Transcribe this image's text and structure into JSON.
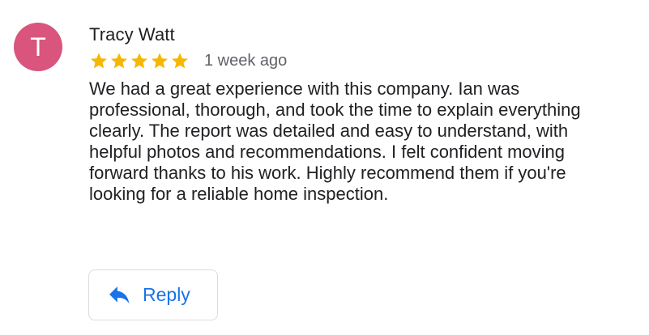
{
  "review": {
    "avatar_initial": "T",
    "avatar_color": "#d9557d",
    "reviewer_name": "Tracy Watt",
    "rating": 5,
    "rating_max": 5,
    "star_color": "#f6b704",
    "time_ago": "1 week ago",
    "text": "We had a great experience with this company. Ian was professional, thorough, and took the time to explain everything clearly. The report was detailed and easy to understand, with helpful photos and recommendations. I felt confident moving forward thanks to his work. Highly recommend them if you're looking for a reliable home inspection."
  },
  "actions": {
    "reply_label": "Reply",
    "reply_icon": "reply-arrow-icon",
    "accent_color": "#1a73e8"
  }
}
